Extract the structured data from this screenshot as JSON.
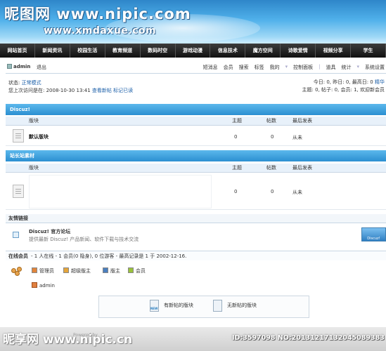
{
  "banner": {
    "watermark_top": "昵图网 www.nipic.com",
    "site_url": "www.xmdaxue.com"
  },
  "nav": [
    "网站首页",
    "新闻资讯",
    "校园生活",
    "教育频道",
    "数码时空",
    "游戏动漫",
    "信息技术",
    "魔方空间",
    "诗歌爱情",
    "视频分享",
    "学生"
  ],
  "toolbar": {
    "user": "admin",
    "logout": "退出",
    "links": [
      "短消息",
      "会员",
      "搜索",
      "标签",
      "我的",
      "控制面板",
      "道具",
      "统计",
      "系统设置"
    ]
  },
  "status": {
    "line1_label": "状态:",
    "line1_value": "正常模式",
    "line2_text": "您上次访问是在: 2008-10-30 13:41",
    "line2_link1": "查看新帖",
    "line2_link2": "标记已读",
    "right1": "今日: 0, 昨日: 0, 最高日: 0",
    "right1_link": "精华",
    "right2": "主题: 0, 帖子: 0, 会员: 1, 欢迎新会员"
  },
  "forum1": {
    "title": "Discuz!",
    "cols": [
      "版块",
      "主题",
      "帖数",
      "最后发表"
    ],
    "rows": [
      {
        "name": "默认版块",
        "topics": "0",
        "posts": "0",
        "last": "从未"
      }
    ]
  },
  "forum2": {
    "title": "站长站素材",
    "cols": [
      "版块",
      "主题",
      "帖数",
      "最后发表"
    ],
    "rows": [
      {
        "name": "",
        "topics": "0",
        "posts": "0",
        "last": "从未"
      }
    ]
  },
  "friend_links": {
    "title": "友情链接",
    "name": "Discuz! 官方论坛",
    "desc": "提供最新 Discuz! 产品新闻、软件下载与技术交流",
    "logo_text": "Discuz! Board"
  },
  "online": {
    "title": "在线会员",
    "summary": "- 1 人在线 - 1 会员(0 隐身), 0 位游客 - 最高记录是 1 于 2002-12-16.",
    "groups": [
      {
        "label": "管理员",
        "color": "#e2843a"
      },
      {
        "label": "超级版主",
        "color": "#e5a53a"
      },
      {
        "label": "版主",
        "color": "#4a7fbf"
      },
      {
        "label": "会员",
        "color": "#9ac23a"
      }
    ],
    "user": "admin"
  },
  "legend_box": {
    "new_label": "有新帖的版块",
    "none_label": "无新帖的版块"
  },
  "footer": {
    "watermark": "昵享网 www.nipic.cn",
    "id_text": "ID:3597098 NO:20131217132045089383",
    "powered": "Powered by"
  }
}
